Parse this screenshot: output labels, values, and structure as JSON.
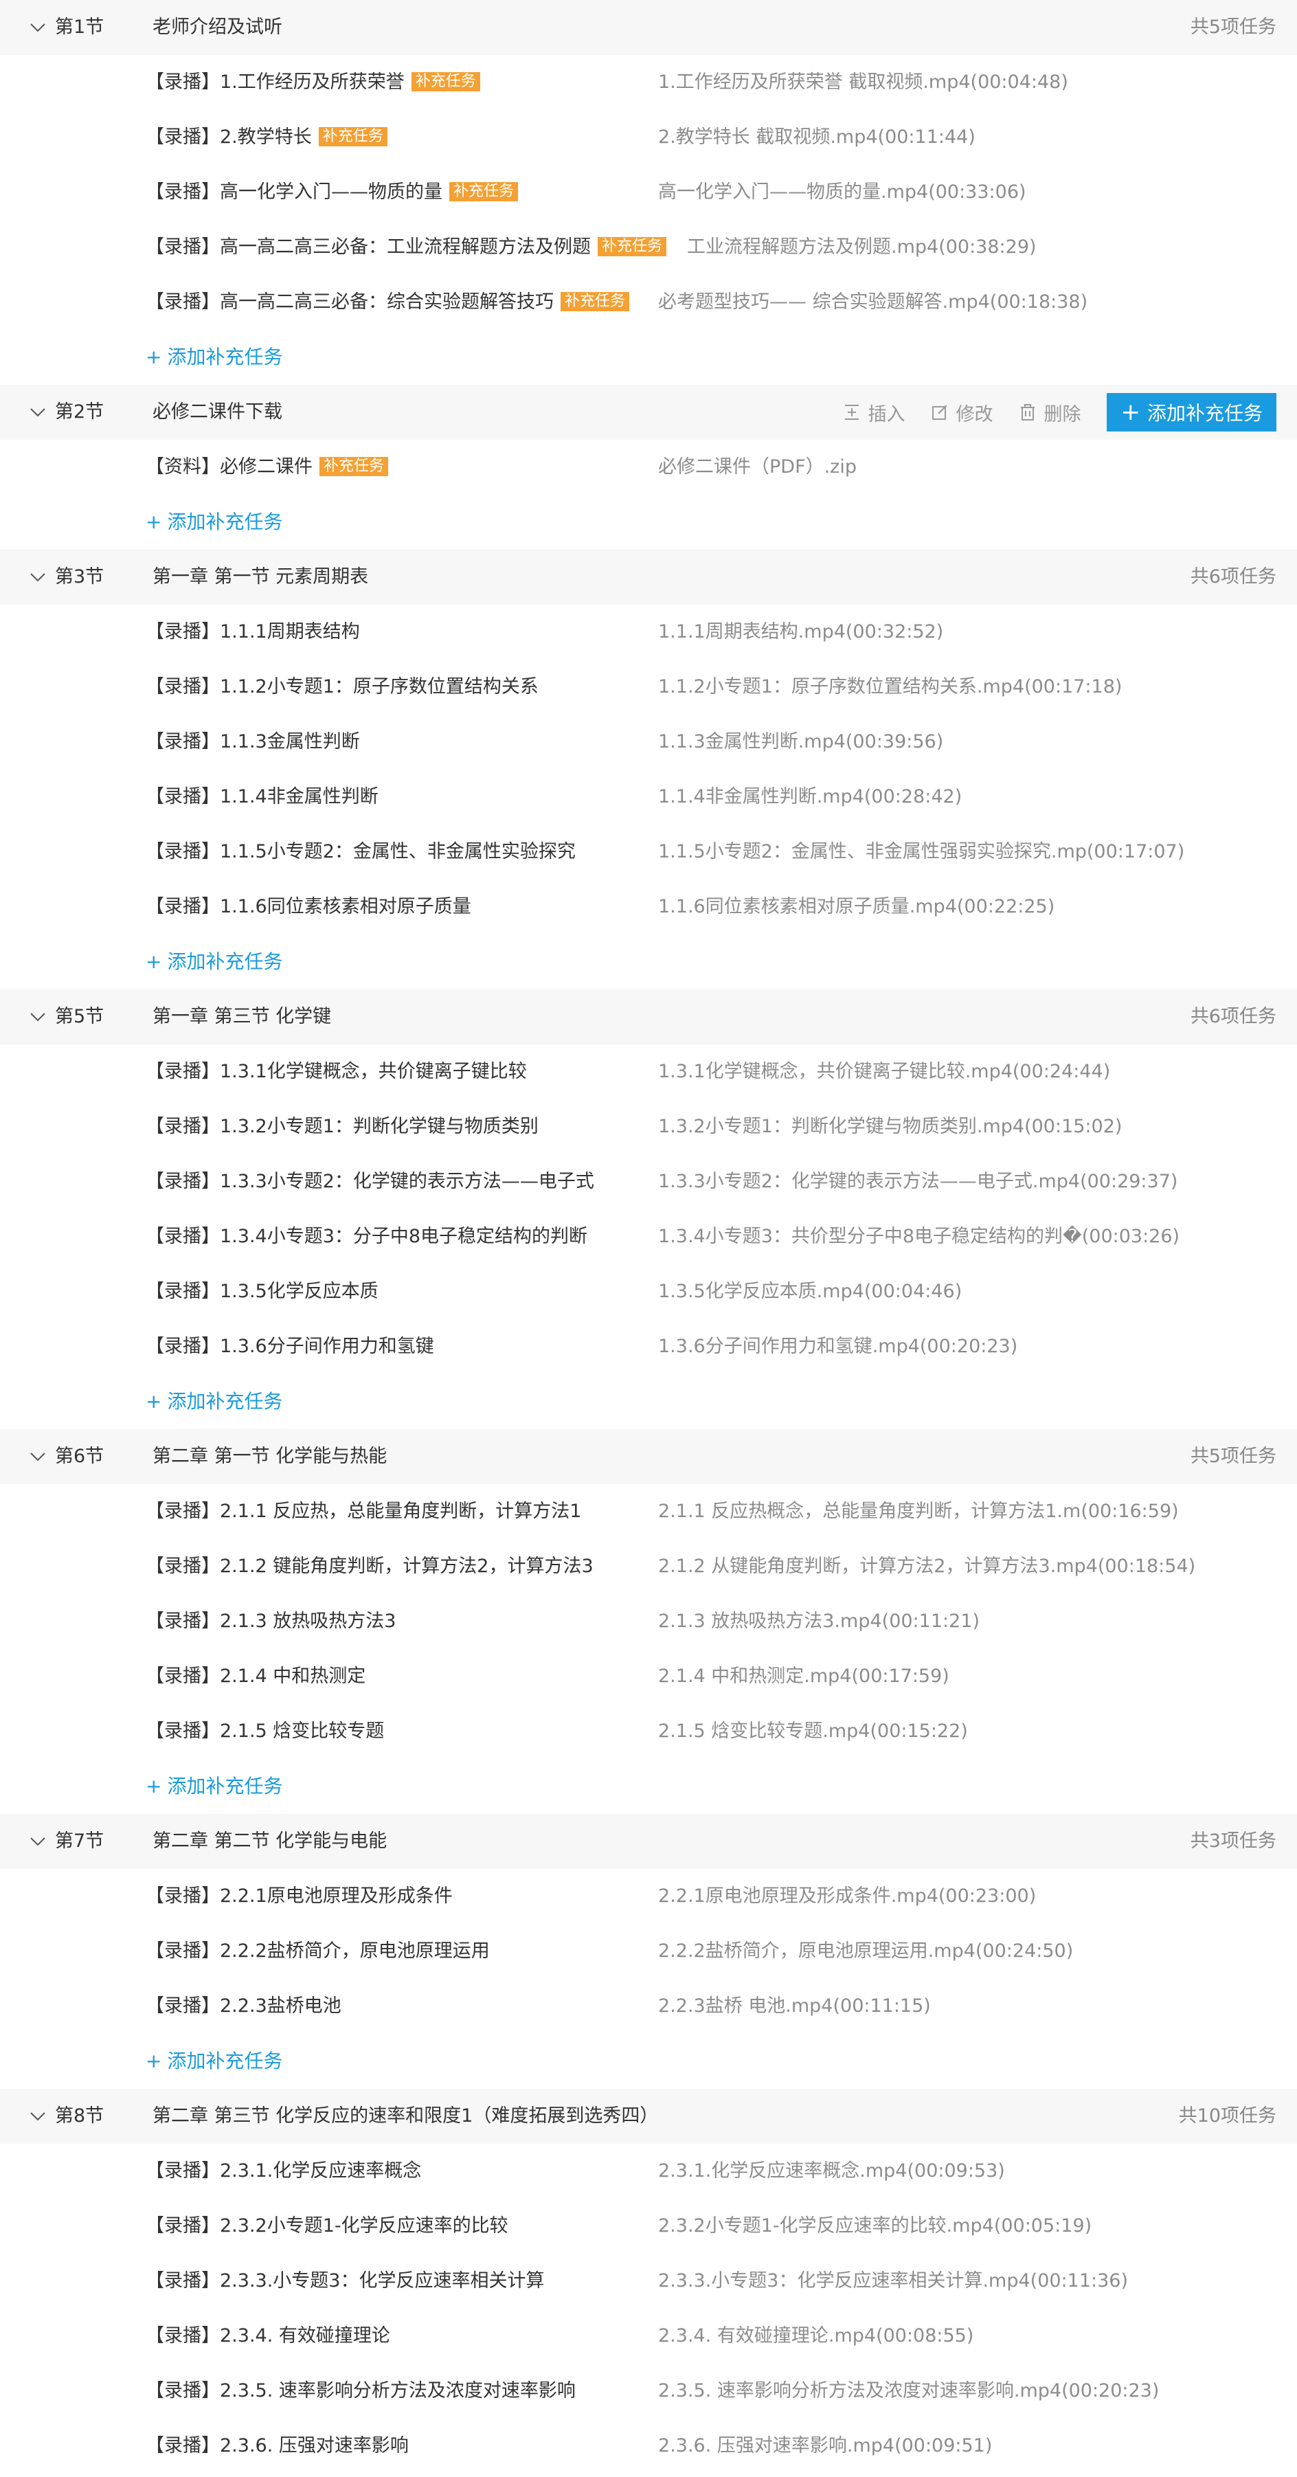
{
  "common": {
    "tag_label": "补充任务",
    "add_link_plus": "+",
    "add_link_label": "添加补充任务"
  },
  "actions": {
    "insert": "插入",
    "edit": "修改",
    "delete": "删除",
    "add_button": "添加补充任务",
    "add_button_plus": "+"
  },
  "sections": [
    {
      "num": "第1节",
      "title": "老师介绍及试听",
      "count": "共5项任务",
      "items": [
        {
          "title": "【录播】1.工作经历及所获荣誉",
          "file": "1.工作经历及所获荣誉 截取视频.mp4(00:04:48)"
        },
        {
          "title": "【录播】2.教学特长",
          "file": "2.教学特长 截取视频.mp4(00:11:44)"
        },
        {
          "title": "【录播】高一化学入门——物质的量",
          "file": "高一化学入门——物质的量.mp4(00:33:06)"
        },
        {
          "title": "【录播】高一高二高三必备：工业流程解题方法及例题",
          "file": "工业流程解题方法及例题.mp4(00:38:29)"
        },
        {
          "title": "【录播】高一高二高三必备：综合实验题解答技巧",
          "file": "必考题型技巧—— 综合实验题解答.mp4(00:18:38)"
        }
      ]
    },
    {
      "num": "第2节",
      "title": "必修二课件下载",
      "count": "",
      "items": [
        {
          "title": "【资料】必修二课件",
          "file": "必修二课件（PDF）.zip"
        }
      ]
    },
    {
      "num": "第3节",
      "title": "第一章 第一节 元素周期表",
      "count": "共6项任务",
      "items": [
        {
          "title": "【录播】1.1.1周期表结构",
          "file": "1.1.1周期表结构.mp4(00:32:52)"
        },
        {
          "title": "【录播】1.1.2小专题1：原子序数位置结构关系",
          "file": "1.1.2小专题1：原子序数位置结构关系.mp4(00:17:18)"
        },
        {
          "title": "【录播】1.1.3金属性判断",
          "file": "1.1.3金属性判断.mp4(00:39:56)"
        },
        {
          "title": "【录播】1.1.4非金属性判断",
          "file": "1.1.4非金属性判断.mp4(00:28:42)"
        },
        {
          "title": "【录播】1.1.5小专题2：金属性、非金属性实验探究",
          "file": "1.1.5小专题2：金属性、非金属性强弱实验探究.mp(00:17:07)"
        },
        {
          "title": "【录播】1.1.6同位素核素相对原子质量",
          "file": "1.1.6同位素核素相对原子质量.mp4(00:22:25)"
        }
      ]
    },
    {
      "num": "第5节",
      "title": "第一章 第三节 化学键",
      "count": "共6项任务",
      "items": [
        {
          "title": "【录播】1.3.1化学键概念，共价键离子键比较",
          "file": "1.3.1化学键概念，共价键离子键比较.mp4(00:24:44)"
        },
        {
          "title": "【录播】1.3.2小专题1：判断化学键与物质类别",
          "file": "1.3.2小专题1：判断化学键与物质类别.mp4(00:15:02)"
        },
        {
          "title": "【录播】1.3.3小专题2：化学键的表示方法——电子式",
          "file": "1.3.3小专题2：化学键的表示方法——电子式.mp4(00:29:37)"
        },
        {
          "title": "【录播】1.3.4小专题3：分子中8电子稳定结构的判断",
          "file": "1.3.4小专题3：共价型分子中8电子稳定结构的判�(00:03:26)"
        },
        {
          "title": "【录播】1.3.5化学反应本质",
          "file": "1.3.5化学反应本质.mp4(00:04:46)"
        },
        {
          "title": "【录播】1.3.6分子间作用力和氢键",
          "file": "1.3.6分子间作用力和氢键.mp4(00:20:23)"
        }
      ]
    },
    {
      "num": "第6节",
      "title": "第二章 第一节  化学能与热能",
      "count": "共5项任务",
      "items": [
        {
          "title": "【录播】2.1.1 反应热，总能量角度判断，计算方法1",
          "file": "2.1.1 反应热概念，总能量角度判断，计算方法1.m(00:16:59)"
        },
        {
          "title": "【录播】2.1.2 键能角度判断，计算方法2，计算方法3",
          "file": "2.1.2 从键能角度判断，计算方法2，计算方法3.mp4(00:18:54)"
        },
        {
          "title": "【录播】2.1.3 放热吸热方法3",
          "file": "2.1.3 放热吸热方法3.mp4(00:11:21)"
        },
        {
          "title": "【录播】2.1.4 中和热测定",
          "file": "2.1.4 中和热测定.mp4(00:17:59)"
        },
        {
          "title": "【录播】2.1.5 焓变比较专题",
          "file": "2.1.5 焓变比较专题.mp4(00:15:22)"
        }
      ]
    },
    {
      "num": "第7节",
      "title": "第二章 第二节 化学能与电能",
      "count": "共3项任务",
      "items": [
        {
          "title": "【录播】2.2.1原电池原理及形成条件",
          "file": "2.2.1原电池原理及形成条件.mp4(00:23:00)"
        },
        {
          "title": "【录播】2.2.2盐桥简介，原电池原理运用",
          "file": "2.2.2盐桥简介，原电池原理运用.mp4(00:24:50)"
        },
        {
          "title": "【录播】2.2.3盐桥电池",
          "file": "2.2.3盐桥 电池.mp4(00:11:15)"
        }
      ]
    },
    {
      "num": "第8节",
      "title": "第二章 第三节 化学反应的速率和限度1（难度拓展到选秀四）",
      "count": "共10项任务",
      "items": [
        {
          "title": "【录播】2.3.1.化学反应速率概念",
          "file": "2.3.1.化学反应速率概念.mp4(00:09:53)"
        },
        {
          "title": "【录播】2.3.2小专题1-化学反应速率的比较",
          "file": "2.3.2小专题1-化学反应速率的比较.mp4(00:05:19)"
        },
        {
          "title": "【录播】2.3.3.小专题3：化学反应速率相关计算",
          "file": "2.3.3.小专题3：化学反应速率相关计算.mp4(00:11:36)"
        },
        {
          "title": "【录播】2.3.4. 有效碰撞理论",
          "file": "2.3.4. 有效碰撞理论.mp4(00:08:55)"
        },
        {
          "title": "【录播】2.3.5. 速率影响分析方法及浓度对速率影响",
          "file": "2.3.5. 速率影响分析方法及浓度对速率影响.mp4(00:20:23)"
        },
        {
          "title": "【录播】2.3.6. 压强对速率影响",
          "file": "2.3.6. 压强对速率影响.mp4(00:09:51)"
        }
      ]
    }
  ]
}
